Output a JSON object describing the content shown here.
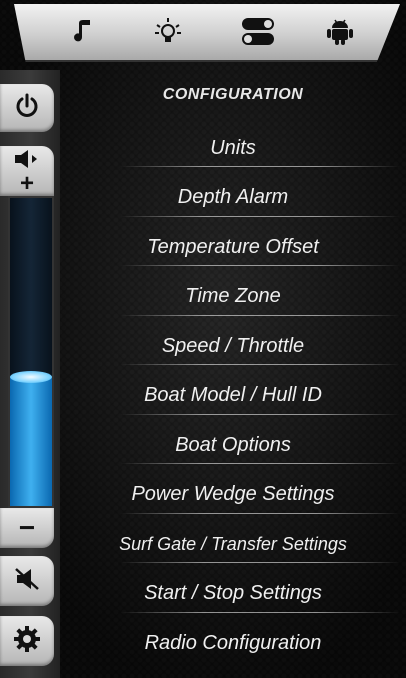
{
  "topbar": {
    "tabs": [
      {
        "name": "music-tab",
        "icon": "music-note-icon"
      },
      {
        "name": "lighting-tab",
        "icon": "light-bulb-icon"
      },
      {
        "name": "toggle-tab",
        "icon": "toggle-switch-icon"
      },
      {
        "name": "android-tab",
        "icon": "android-robot-icon"
      }
    ]
  },
  "sidebar": {
    "power_icon": "power-icon",
    "volume_icon": "speaker-volume-icon",
    "volume_plus": "+",
    "volume_minus": "−",
    "volume_level": 0.42,
    "volume_fill_color": "#2aa2ec",
    "mute_icon": "speaker-mute-icon",
    "settings_icon": "gear-icon"
  },
  "menu": {
    "title": "CONFIGURATION",
    "items": [
      {
        "label": "Units"
      },
      {
        "label": "Depth Alarm"
      },
      {
        "label": "Temperature Offset"
      },
      {
        "label": "Time Zone"
      },
      {
        "label": "Speed / Throttle"
      },
      {
        "label": "Boat Model / Hull ID"
      },
      {
        "label": "Boat Options"
      },
      {
        "label": "Power Wedge Settings"
      },
      {
        "label": "Surf Gate / Transfer Settings"
      },
      {
        "label": "Start / Stop Settings"
      },
      {
        "label": "Radio Configuration"
      }
    ]
  }
}
